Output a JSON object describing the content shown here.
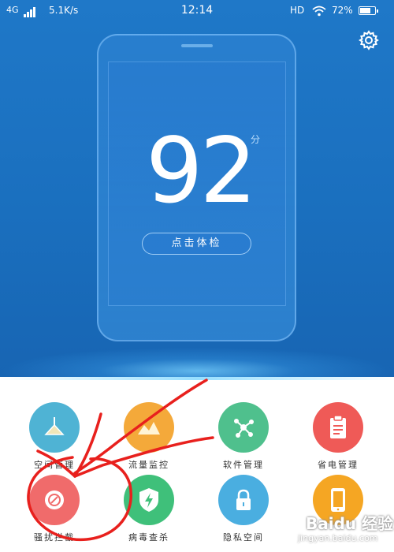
{
  "status_bar": {
    "network": "4G",
    "speed": "5.1K/s",
    "time": "12:14",
    "hd": "HD",
    "battery_pct": "72%",
    "battery_level": 0.72
  },
  "header": {
    "settings_icon": "gear-icon"
  },
  "score": {
    "value": "92",
    "unit": "分"
  },
  "check_button": {
    "label": "点击体检"
  },
  "tiles": [
    {
      "label": "空间管理",
      "icon": "broom-icon",
      "color": "#4fb3d4"
    },
    {
      "label": "流量监控",
      "icon": "chart-icon",
      "color": "#f4a93a"
    },
    {
      "label": "软件管理",
      "icon": "molecule-icon",
      "color": "#4fc08d"
    },
    {
      "label": "省电管理",
      "icon": "clipboard-icon",
      "color": "#ef5a57"
    },
    {
      "label": "骚扰拦截",
      "icon": "shield-block-icon",
      "color": "#f06b6b"
    },
    {
      "label": "病毒查杀",
      "icon": "shield-bolt-icon",
      "color": "#3fc07a"
    },
    {
      "label": "隐私空间",
      "icon": "lock-icon",
      "color": "#4aaee0"
    },
    {
      "label": "",
      "icon": "phone-icon",
      "color": "#f5a623"
    }
  ],
  "watermark": {
    "brand": "Baidu 经验",
    "url": "jingyan.baidu.com"
  }
}
